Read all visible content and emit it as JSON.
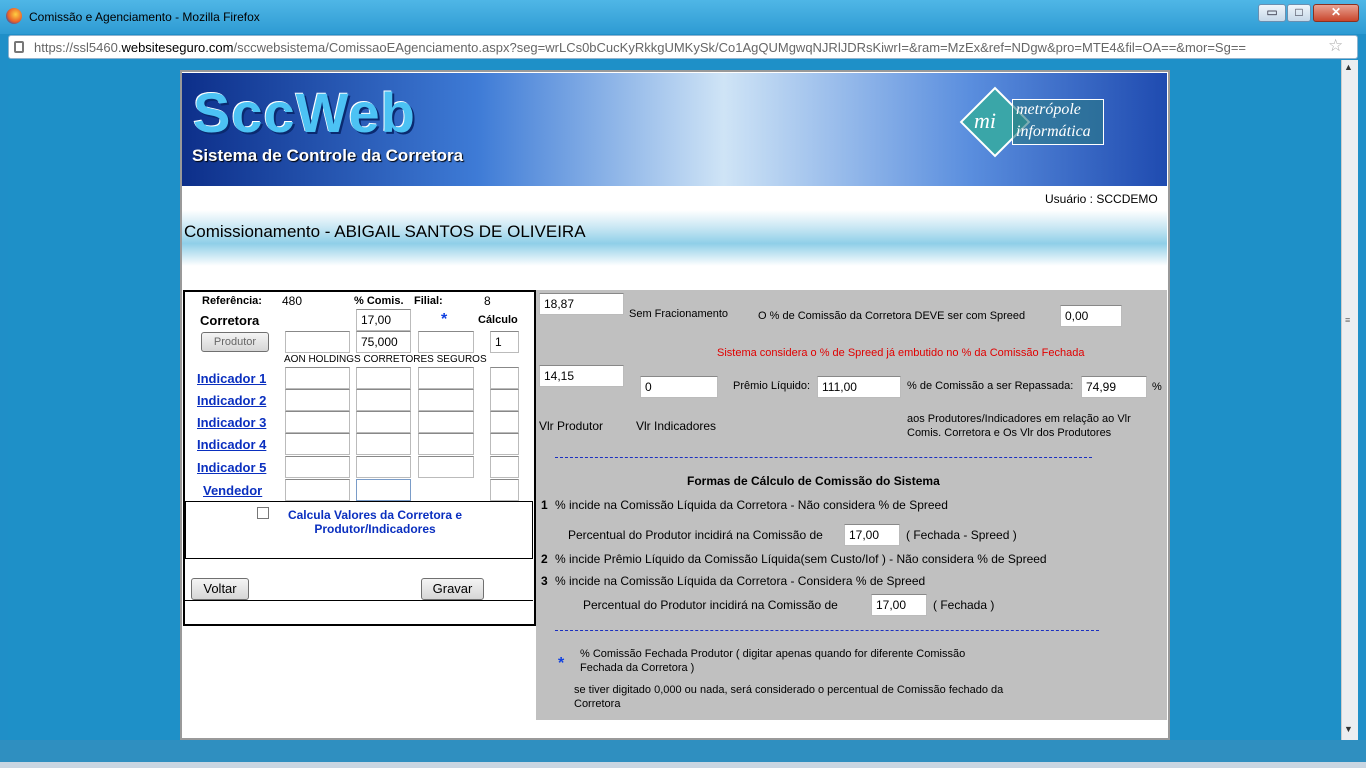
{
  "window": {
    "title": "Comissão e Agenciamento - Mozilla Firefox",
    "btn_min": "▭",
    "btn_max": "□",
    "btn_close": "✕",
    "url_prefix": "https://ssl5460.",
    "url_domain": "websiteseguro.com",
    "url_rest": "/sccwebsistema/ComissaoEAgenciamento.aspx?seg=wrLCs0bCucKyRkkgUMKySk/Co1AgQUMgwqNJRlJDRsKiwrI=&ram=MzEx&ref=NDgw&pro=MTE4&fil=OA==&mor=Sg=="
  },
  "header": {
    "logo_title": "SccWeb",
    "logo_subtitle": "Sistema de Controle da Corretora",
    "partner_mi": "mi",
    "partner_line1": "metrópole",
    "partner_line2": "informática",
    "user": "Usuário : SCCDEMO",
    "page_title": "Comissionamento - ABIGAIL SANTOS DE OLIVEIRA"
  },
  "form": {
    "ref_label": "Referência:",
    "ref_value": "480",
    "comis_label": "% Comis.",
    "filial_label": "Filial:",
    "filial_value": "8",
    "corretora_label": "Corretora",
    "corretora_comis": "17,00",
    "star": "*",
    "calculo_label": "Cálculo",
    "produtor_button": "Produtor",
    "produtor_comis": "75,000",
    "calculo_value": "1",
    "produtor_name": "AON HOLDINGS CORRETORES SEGUROS",
    "indicador1": "Indicador 1",
    "indicador2": "Indicador 2",
    "indicador3": "Indicador 3",
    "indicador4": "Indicador 4",
    "indicador5": "Indicador 5",
    "vendedor": "Vendedor",
    "calcula_label": "Calcula Valores da Corretora e Produtor/Indicadores",
    "voltar": "Voltar",
    "gravar": "Gravar"
  },
  "right": {
    "valor1": "18,87",
    "sem_frac": "Sem Fracionamento",
    "spreed_note": "O % de Comissão da Corretora DEVE ser com Spreed",
    "spreed_value": "0,00",
    "red_note": "Sistema considera o % de Spreed já embutido no % da Comissão Fechada",
    "valor2": "14,15",
    "valor3": "0",
    "premio_label": "Prêmio Líquido:",
    "premio_value": "111,00",
    "repassada_label": "% de Comissão a ser Repassada:",
    "repassada_value": "74,99",
    "pct": "%",
    "vlr_produtor": "Vlr Produtor",
    "vlr_indicadores": "Vlr Indicadores",
    "aos_note_1": "aos Produtores/Indicadores em relação ao Vlr",
    "aos_note_2": "Comis. Corretora e Os Vlr dos Produtores",
    "formas_title": "Formas de Cálculo de Comissão do Sistema",
    "n1": "1",
    "f1": "% incide na Comissão Líquida da Corretora - Não considera % de Spreed",
    "perc1_label": "Percentual do Produtor incidirá na Comissão de",
    "perc1_value": "17,00",
    "perc1_suffix": "( Fechada - Spreed )",
    "n2": "2",
    "f2": "% incide Prêmio Líquido da Comissão Líquida(sem Custo/Iof ) - Não considera % de Spreed",
    "n3": "3",
    "f3": "% incide na Comissão Líquida da Corretora - Considera % de Spreed",
    "perc3_label": "Percentual do Produtor incidirá na Comissão de",
    "perc3_value": "17,00",
    "perc3_suffix": "( Fechada )",
    "star": "*",
    "note1_a": "% Comissão Fechada Produtor ( digitar apenas quando for diferente Comissão",
    "note1_b": "Fechada da Corretora )",
    "note2_a": "se tiver digitado 0,000 ou nada, será considerado o percentual de Comissão fechado da",
    "note2_b": "Corretora"
  }
}
